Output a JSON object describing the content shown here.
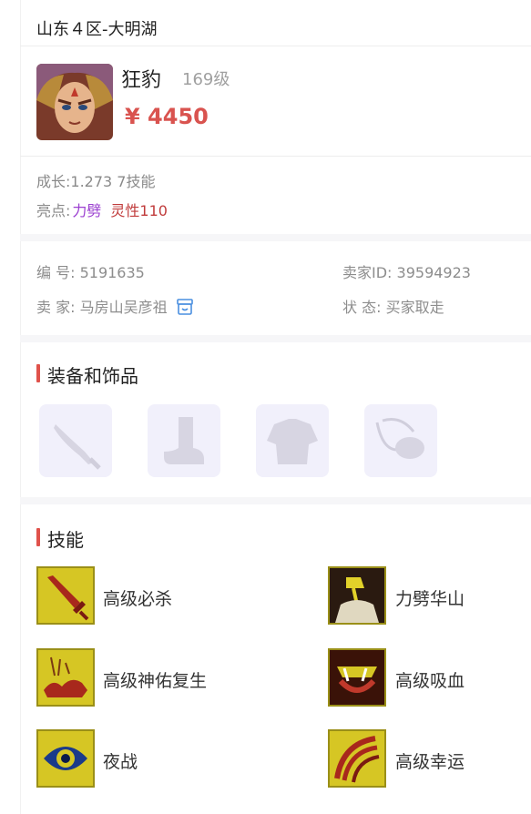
{
  "header": {
    "server": "山东４区-大明湖"
  },
  "role": {
    "name": "狂豹",
    "level": "169级",
    "price": "¥ 4450"
  },
  "stats": {
    "growth": "成长:1.273 7技能",
    "highlights_label": "亮点:",
    "highlight_1": "力劈",
    "highlight_2": "灵性110"
  },
  "info": {
    "id_label": "编 号:",
    "id_value": "5191635",
    "seller_label": "卖 家:",
    "seller_value": "马房山吴彦祖",
    "seller_id_label": "卖家ID:",
    "seller_id_value": "39594923",
    "status_label": "状 态:",
    "status_value": "买家取走"
  },
  "equipment": {
    "title": "装备和饰品",
    "items": [
      {
        "icon": "weapon-icon"
      },
      {
        "icon": "boot-icon"
      },
      {
        "icon": "armor-icon"
      },
      {
        "icon": "necklace-icon"
      }
    ]
  },
  "skills": {
    "title": "技能",
    "items": [
      {
        "name": "高级必杀",
        "icon": "sword-skill-icon"
      },
      {
        "name": "力劈华山",
        "icon": "axe-skill-icon"
      },
      {
        "name": "高级神佑复生",
        "icon": "revive-skill-icon"
      },
      {
        "name": "高级吸血",
        "icon": "fang-skill-icon"
      },
      {
        "name": "夜战",
        "icon": "eye-skill-icon"
      },
      {
        "name": "高级幸运",
        "icon": "luck-skill-icon"
      }
    ]
  },
  "colors": {
    "price": "#d9534f",
    "accent": "#e0524b",
    "highlight_1": "#9b3fd0",
    "highlight_2": "#c03b3b",
    "skill_bg": "#d6c624"
  }
}
